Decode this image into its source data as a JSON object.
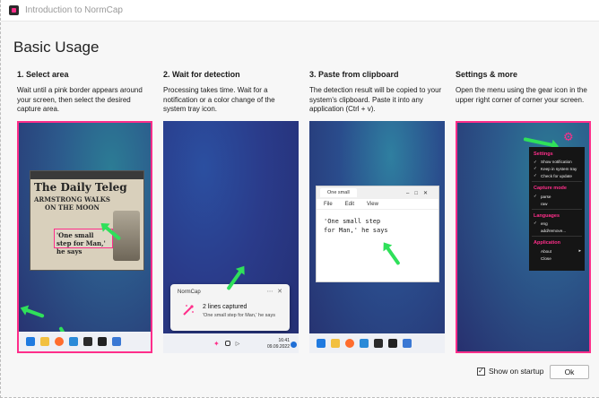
{
  "window": {
    "title": "Introduction to NormCap",
    "heading": "Basic Usage"
  },
  "colors": {
    "accent": "#ff2e8a",
    "arrow": "#2fe05a",
    "background": "#f7f7f7"
  },
  "steps": [
    {
      "title": "1. Select area",
      "description": "Wait until a pink border appears around your screen, then select the desired capture area."
    },
    {
      "title": "2. Wait for detection",
      "description": "Processing takes time. Wait for a notification or a color change of the system tray icon."
    },
    {
      "title": "3. Paste from clipboard",
      "description": "The detection result will be copied to your system's clipboard. Paste it into any application (Ctrl + v)."
    },
    {
      "title": "Settings & more",
      "description": "Open the menu using the gear icon in the upper right corner of corner your screen."
    }
  ],
  "shot1": {
    "paper_head": "The Daily Teleg",
    "lines": [
      "ARMSTRONG WALKS",
      "ON THE MOON"
    ],
    "selection": "'One small step for Man,' he says"
  },
  "shot2": {
    "app": "NormCap",
    "title": "2 lines captured",
    "body": "'One small step for Man,' he says",
    "time": "16:41",
    "date": "09.09.2022"
  },
  "shot3": {
    "tab": "One small",
    "menu": [
      "File",
      "Edit",
      "View"
    ],
    "text": "'One small step\nfor Man,' he says"
  },
  "shot4": {
    "sections": [
      {
        "label": "Settings",
        "items": [
          {
            "label": "Show notification",
            "checked": true
          },
          {
            "label": "Keep in system tray",
            "checked": true
          },
          {
            "label": "Check for update",
            "checked": true
          }
        ]
      },
      {
        "label": "Capture mode",
        "items": [
          {
            "label": "parse",
            "checked": true
          },
          {
            "label": "raw",
            "checked": false
          }
        ]
      },
      {
        "label": "Languages",
        "items": [
          {
            "label": "eng",
            "checked": true
          },
          {
            "label": "add/remove...",
            "checked": false
          }
        ]
      },
      {
        "label": "Application",
        "items": [
          {
            "label": "About",
            "checked": false,
            "sub": true
          },
          {
            "label": "Close",
            "checked": false
          }
        ]
      }
    ]
  },
  "footer": {
    "startup_label": "Show on startup",
    "startup_checked": true,
    "ok_label": "Ok"
  }
}
